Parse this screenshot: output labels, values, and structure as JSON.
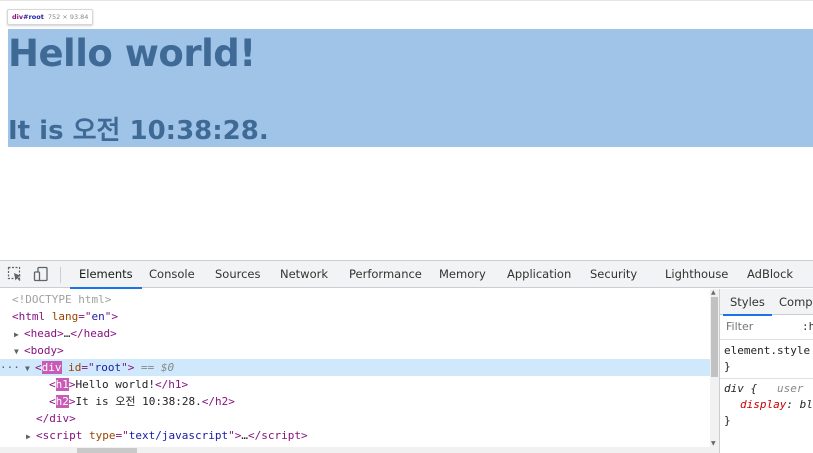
{
  "page": {
    "h1": "Hello world!",
    "h2": "It is 오전 10:38:28.",
    "tooltip": {
      "name": "div",
      "id": "#root",
      "size": "752 × 93.84"
    }
  },
  "devtools": {
    "tabs": [
      "Elements",
      "Console",
      "Sources",
      "Network",
      "Performance",
      "Memory",
      "Application",
      "Security",
      "Lighthouse",
      "AdBlock"
    ],
    "active_tab": "Elements",
    "icons": [
      "inspect-element-icon",
      "device-toggle-icon"
    ],
    "dom": {
      "doctype": "<!DOCTYPE html>",
      "html_open": {
        "tag": "html",
        "attr": "lang",
        "value": "en"
      },
      "head": {
        "tag": "head",
        "ellipsis": "…"
      },
      "body_tag": "body",
      "div": {
        "tag": "div",
        "attr": "id",
        "value": "root",
        "marker": "== $0"
      },
      "h1": {
        "tag": "h1",
        "text": "Hello world!"
      },
      "h2": {
        "tag": "h2",
        "text": "It is 오전 10:38:28."
      },
      "div_close": "div",
      "script": {
        "tag": "script",
        "attr": "type",
        "value": "text/javascript",
        "ellipsis": "…"
      }
    },
    "styles": {
      "tabs": [
        "Styles",
        "Compu"
      ],
      "filter_placeholder": "Filter",
      "hov": ":h",
      "element_style": "element.style {",
      "close_brace": "}",
      "div_rule": {
        "selector": "div {",
        "source": "user",
        "property": "display",
        "value": "bl"
      }
    }
  },
  "colors": {
    "highlight": "#a0c4e8",
    "heading_text": "#3f6a96",
    "selected_row": "#cfe8fc",
    "tag": "#881280",
    "attribute": "#994500",
    "value": "#1a1aa6",
    "active_tab_underline": "#1a73e8"
  }
}
